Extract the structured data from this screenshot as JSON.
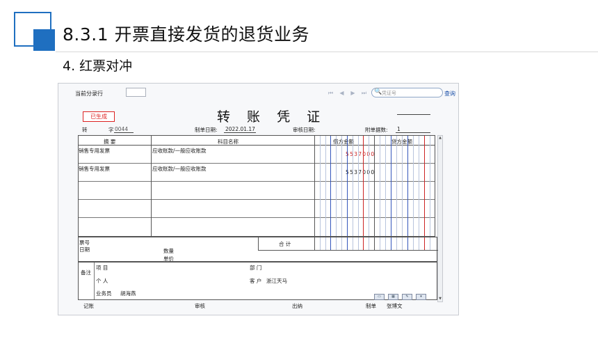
{
  "slide": {
    "title": "8.3.1  开票直接发货的退货业务",
    "subtitle": "4. 红票对冲"
  },
  "toolbar": {
    "split_row_label": "当前分录行",
    "search_placeholder": "凭证号",
    "query_label": "查询"
  },
  "voucher": {
    "status": "已生成",
    "title": "转 账 凭 证",
    "type_char": "转",
    "number_label": "字",
    "number_value": "0044",
    "date_label": "制单日期:",
    "date_value": "2022.01.17",
    "audit_date_label": "审核日期:",
    "attachments_label": "附单据数:",
    "attachments_value": "1"
  },
  "table": {
    "headers": {
      "summary": "摘 要",
      "account": "科目名称",
      "debit": "借方金额",
      "credit": "贷方金额"
    },
    "rows": [
      {
        "summary": "销售专用发票",
        "account": "应收账款/一般应收账款",
        "debit": "5537000",
        "credit": ""
      },
      {
        "summary": "销售专用发票",
        "account": "应收账款/一般应收账款",
        "debit": "5537000",
        "credit": ""
      }
    ],
    "debit_colors": [
      "#cc2222",
      "#222222"
    ]
  },
  "footer": {
    "ticket_no_label": "票号",
    "date_label": "日期",
    "qty_label": "数量",
    "unit_price_label": "单价",
    "total_label": "合 计",
    "remark_label": "备注",
    "project_label": "项 目",
    "dept_label": "部 门",
    "person_label": "个 人",
    "customer_label": "客 户",
    "customer_value": "浙江天马",
    "salesman_label": "业务员",
    "salesman_value": "胡海燕",
    "bookkeep_label": "记账",
    "audit_label": "审核",
    "cashier_label": "出纳",
    "maker_label": "制单",
    "maker_value": "张博文"
  },
  "colors": {
    "accent": "#1f6fc0",
    "red_line": "#cc2222",
    "blue_line": "#3355bb",
    "stamp": "#dd2222"
  },
  "icons": [
    "first-page-icon",
    "prev-page-icon",
    "next-page-icon",
    "last-page-icon",
    "search-icon"
  ]
}
